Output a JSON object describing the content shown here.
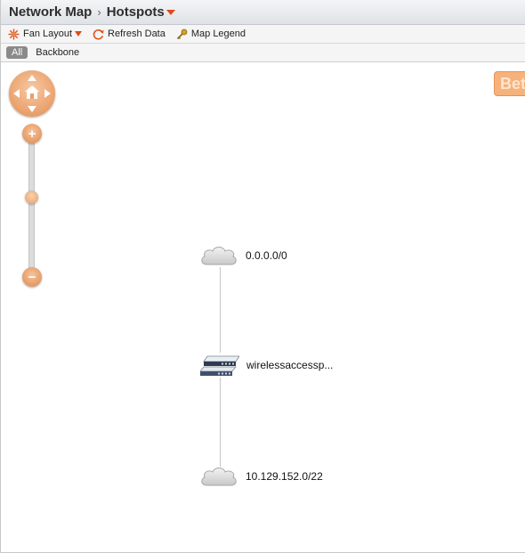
{
  "breadcrumb": {
    "root": "Network Map",
    "separator": "›",
    "current": "Hotspots"
  },
  "toolbar": {
    "layout_label": "Fan Layout",
    "refresh_label": "Refresh Data",
    "legend_label": "Map Legend"
  },
  "filters": {
    "all_label": "All",
    "backbone_label": "Backbone"
  },
  "map": {
    "corner_badge": "Bet",
    "zoom_in": "+",
    "zoom_out": "−",
    "nodes": [
      {
        "label": "0.0.0.0/0",
        "kind": "cloud-icon"
      },
      {
        "label": "wirelessaccessp...",
        "kind": "switch-icon"
      },
      {
        "label": "10.129.152.0/22",
        "kind": "cloud-icon"
      }
    ]
  },
  "colors": {
    "accent": "#e04a1c",
    "control_orange": "#e9a06a",
    "edge": "#c6c6c6"
  }
}
